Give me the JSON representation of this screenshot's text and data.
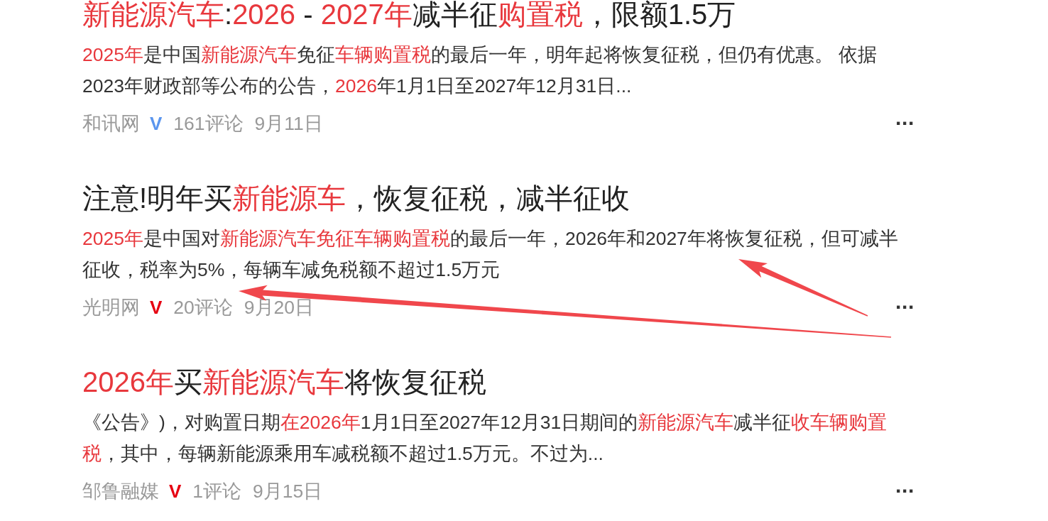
{
  "results": [
    {
      "title": [
        {
          "text": "新能源汽车",
          "highlight": true
        },
        {
          "text": ":",
          "highlight": false
        },
        {
          "text": "2026",
          "highlight": true
        },
        {
          "text": " - ",
          "highlight": false
        },
        {
          "text": "2027年",
          "highlight": true
        },
        {
          "text": "减半征",
          "highlight": false
        },
        {
          "text": "购置税",
          "highlight": true
        },
        {
          "text": "，限额1.5万",
          "highlight": false
        }
      ],
      "snippet": [
        {
          "text": "2025年",
          "highlight": true
        },
        {
          "text": "是中国",
          "highlight": false
        },
        {
          "text": "新能源汽车",
          "highlight": true
        },
        {
          "text": "免征",
          "highlight": false
        },
        {
          "text": "车辆购置税",
          "highlight": true
        },
        {
          "text": "的最后一年，明年起将恢复征税，但仍有优惠。 依据2023年财政部等公布的公告，",
          "highlight": false
        },
        {
          "text": "2026",
          "highlight": true
        },
        {
          "text": "年1月1日至2027年12月31日...",
          "highlight": false
        }
      ],
      "source": "和讯网",
      "badge": {
        "text": "V",
        "color": "#5b96ee"
      },
      "comments": "161评论",
      "date": "9月11日",
      "more": "···"
    },
    {
      "title": [
        {
          "text": "注意!明年买",
          "highlight": false
        },
        {
          "text": "新能源车",
          "highlight": true
        },
        {
          "text": "，恢复征税，减半征收",
          "highlight": false
        }
      ],
      "snippet": [
        {
          "text": "2025年",
          "highlight": true
        },
        {
          "text": "是中国对",
          "highlight": false
        },
        {
          "text": "新能源汽车免征车辆购置税",
          "highlight": true
        },
        {
          "text": "的最后一年，2026年和2027年将恢复征税，但可减半征收，税率为5%，每辆车减免税额不超过1.5万元",
          "highlight": false
        }
      ],
      "source": "光明网",
      "badge": {
        "text": "V",
        "color": "#e60012"
      },
      "comments": "20评论",
      "date": "9月20日",
      "more": "···"
    },
    {
      "title": [
        {
          "text": "2026年",
          "highlight": true
        },
        {
          "text": "买",
          "highlight": false
        },
        {
          "text": "新能源汽车",
          "highlight": true
        },
        {
          "text": "将恢复征税",
          "highlight": false
        }
      ],
      "snippet": [
        {
          "text": "《公告》)，对购置日期",
          "highlight": false
        },
        {
          "text": "在2026年",
          "highlight": true
        },
        {
          "text": "1月1日至2027年12月31日期间的",
          "highlight": false
        },
        {
          "text": "新能源汽车",
          "highlight": true
        },
        {
          "text": "减半征",
          "highlight": false
        },
        {
          "text": "收车辆购置税",
          "highlight": true
        },
        {
          "text": "，其中，每辆新能源乘用车减税额不超过1.5万元。不过为...",
          "highlight": false
        }
      ],
      "source": "邹鲁融媒",
      "badge": {
        "text": "V",
        "color": "#e60012"
      },
      "comments": "1评论",
      "date": "9月15日",
      "more": "···"
    }
  ],
  "annotations": [
    {
      "kind": "arrow"
    },
    {
      "kind": "arrow"
    }
  ]
}
